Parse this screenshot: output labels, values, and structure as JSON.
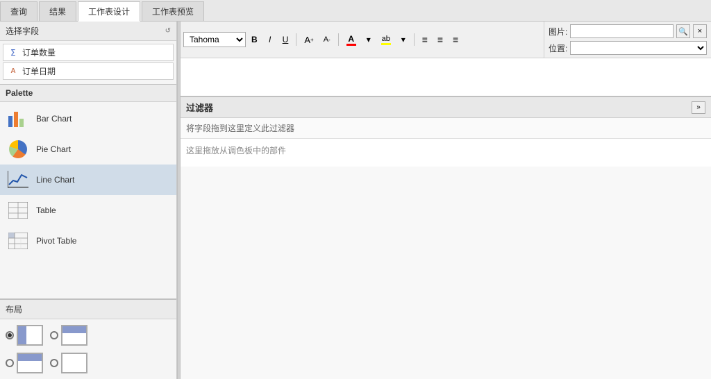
{
  "tabs": [
    {
      "label": "查询",
      "active": false
    },
    {
      "label": "结果",
      "active": false
    },
    {
      "label": "工作表设计",
      "active": true
    },
    {
      "label": "工作表预览",
      "active": false
    }
  ],
  "left": {
    "fields_section_label": "选择字段",
    "refresh_icon": "↺",
    "fields": [
      {
        "icon": "∑",
        "type": "numeric",
        "label": "订单数量"
      },
      {
        "icon": "A",
        "type": "date",
        "label": "订单日期"
      }
    ],
    "palette_label": "Palette",
    "palette_items": [
      {
        "id": "bar-chart",
        "label": "Bar Chart"
      },
      {
        "id": "pie-chart",
        "label": "Pie Chart"
      },
      {
        "id": "line-chart",
        "label": "Line Chart",
        "selected": true
      },
      {
        "id": "table",
        "label": "Table"
      },
      {
        "id": "pivot-table",
        "label": "Pivot Table"
      }
    ],
    "layout_label": "布局",
    "layout_options": [
      {
        "id": "layout-left",
        "selected": true
      },
      {
        "id": "layout-right",
        "selected": false
      }
    ]
  },
  "toolbar": {
    "font_name": "Tahoma",
    "buttons": [
      "B",
      "I",
      "U",
      "A↑",
      "A↓"
    ],
    "font_color_label": "A",
    "highlight_label": "ab",
    "align_buttons": [
      "≡",
      "≡",
      "≡"
    ]
  },
  "right_fields": {
    "image_label": "图片:",
    "position_label": "位置:",
    "image_placeholder": "",
    "position_options": [
      ""
    ]
  },
  "text_area": {
    "content": ""
  },
  "filter": {
    "title": "过滤器",
    "collapse_icon": "»",
    "hint": "将字段拖到这里定义此过滤器",
    "drop_hint": "这里拖放从调色板中的部件"
  }
}
